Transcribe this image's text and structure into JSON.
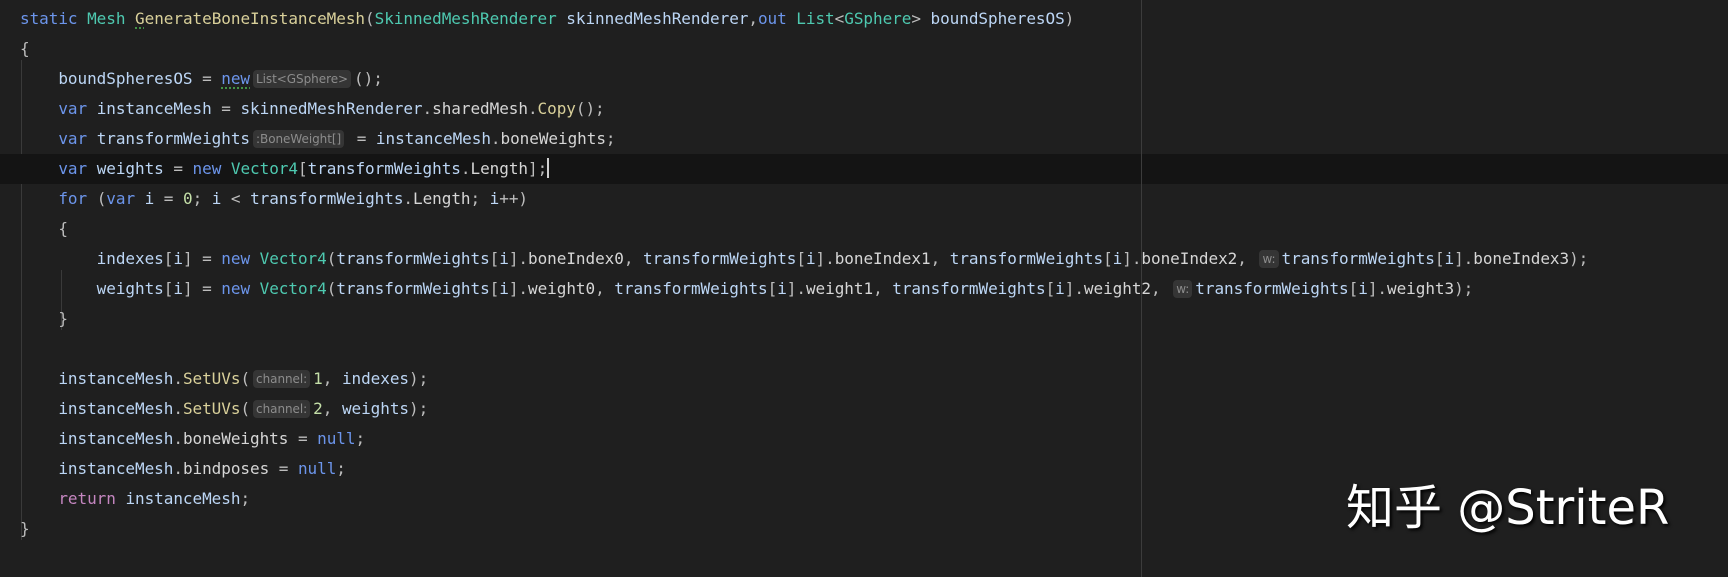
{
  "editor": {
    "current_line": 5,
    "lines": [
      [
        [
          "kw",
          "static "
        ],
        [
          "ty",
          "Mesh "
        ],
        [
          "fn warn",
          "G"
        ],
        [
          "fn",
          "enerateBoneInstanceMesh"
        ],
        [
          "pl",
          "("
        ],
        [
          "ty",
          "SkinnedMeshRenderer "
        ],
        [
          "id",
          "skinnedMeshRenderer"
        ],
        [
          "pl",
          ","
        ],
        [
          "kw",
          "out "
        ],
        [
          "ty",
          "List"
        ],
        [
          "pl",
          "<"
        ],
        [
          "ty",
          "GSphere"
        ],
        [
          "pl",
          "> "
        ],
        [
          "id",
          "boundSpheresOS"
        ],
        [
          "pl",
          ")"
        ]
      ],
      [
        [
          "pl",
          "{"
        ]
      ],
      [
        [
          "pl",
          "    "
        ],
        [
          "id",
          "boundSpheresOS "
        ],
        [
          "pl",
          "= "
        ],
        [
          "kw warn",
          "new"
        ],
        [
          "hint",
          "List<GSphere>"
        ],
        [
          "pl",
          "();"
        ]
      ],
      [
        [
          "pl",
          "    "
        ],
        [
          "kw",
          "var "
        ],
        [
          "id",
          "instanceMesh "
        ],
        [
          "pl",
          "= "
        ],
        [
          "id",
          "skinnedMeshRenderer"
        ],
        [
          "pl",
          "."
        ],
        [
          "field",
          "sharedMesh"
        ],
        [
          "pl",
          "."
        ],
        [
          "fn",
          "Copy"
        ],
        [
          "pl",
          "();"
        ]
      ],
      [
        [
          "pl",
          "    "
        ],
        [
          "kw",
          "var "
        ],
        [
          "id",
          "transformWeights"
        ],
        [
          "hint",
          ":BoneWeight[]"
        ],
        [
          "pl",
          " = "
        ],
        [
          "id",
          "instanceMesh"
        ],
        [
          "pl",
          "."
        ],
        [
          "field",
          "boneWeights"
        ],
        [
          "pl",
          ";"
        ]
      ],
      [
        [
          "pl",
          "    "
        ],
        [
          "kw",
          "var "
        ],
        [
          "id",
          "weights "
        ],
        [
          "pl",
          "= "
        ],
        [
          "kw",
          "new "
        ],
        [
          "ty",
          "Vector4"
        ],
        [
          "pl",
          "["
        ],
        [
          "id",
          "transformWeights"
        ],
        [
          "pl",
          "."
        ],
        [
          "field",
          "Length"
        ],
        [
          "pl",
          "];"
        ],
        [
          "caret",
          ""
        ]
      ],
      [
        [
          "pl",
          "    "
        ],
        [
          "kw",
          "for "
        ],
        [
          "pl",
          "("
        ],
        [
          "kw",
          "var "
        ],
        [
          "id",
          "i "
        ],
        [
          "pl",
          "= "
        ],
        [
          "num",
          "0"
        ],
        [
          "pl",
          "; "
        ],
        [
          "id",
          "i "
        ],
        [
          "pl",
          "< "
        ],
        [
          "id",
          "transformWeights"
        ],
        [
          "pl",
          "."
        ],
        [
          "field",
          "Length"
        ],
        [
          "pl",
          "; "
        ],
        [
          "id",
          "i"
        ],
        [
          "pl",
          "++)"
        ]
      ],
      [
        [
          "pl",
          "    {"
        ]
      ],
      [
        [
          "pl",
          "        "
        ],
        [
          "id",
          "indexes"
        ],
        [
          "pl",
          "["
        ],
        [
          "id",
          "i"
        ],
        [
          "pl",
          "] = "
        ],
        [
          "kw",
          "new "
        ],
        [
          "ty",
          "Vector4"
        ],
        [
          "pl",
          "("
        ],
        [
          "id",
          "transformWeights"
        ],
        [
          "pl",
          "["
        ],
        [
          "id",
          "i"
        ],
        [
          "pl",
          "]."
        ],
        [
          "field",
          "boneIndex0"
        ],
        [
          "pl",
          ", "
        ],
        [
          "id",
          "transformWeights"
        ],
        [
          "pl",
          "["
        ],
        [
          "id",
          "i"
        ],
        [
          "pl",
          "]."
        ],
        [
          "field",
          "boneIndex1"
        ],
        [
          "pl",
          ", "
        ],
        [
          "id",
          "transformWeights"
        ],
        [
          "pl",
          "["
        ],
        [
          "id",
          "i"
        ],
        [
          "pl",
          "]."
        ],
        [
          "field",
          "boneIndex2"
        ],
        [
          "pl",
          ", "
        ],
        [
          "hint",
          "w:"
        ],
        [
          "id",
          "transformWeights"
        ],
        [
          "pl",
          "["
        ],
        [
          "id",
          "i"
        ],
        [
          "pl",
          "]."
        ],
        [
          "field",
          "boneIndex3"
        ],
        [
          "pl",
          ");"
        ]
      ],
      [
        [
          "pl",
          "        "
        ],
        [
          "id",
          "weights"
        ],
        [
          "pl",
          "["
        ],
        [
          "id",
          "i"
        ],
        [
          "pl",
          "] = "
        ],
        [
          "kw",
          "new "
        ],
        [
          "ty",
          "Vector4"
        ],
        [
          "pl",
          "("
        ],
        [
          "id",
          "transformWeights"
        ],
        [
          "pl",
          "["
        ],
        [
          "id",
          "i"
        ],
        [
          "pl",
          "]."
        ],
        [
          "field",
          "weight0"
        ],
        [
          "pl",
          ", "
        ],
        [
          "id",
          "transformWeights"
        ],
        [
          "pl",
          "["
        ],
        [
          "id",
          "i"
        ],
        [
          "pl",
          "]."
        ],
        [
          "field",
          "weight1"
        ],
        [
          "pl",
          ", "
        ],
        [
          "id",
          "transformWeights"
        ],
        [
          "pl",
          "["
        ],
        [
          "id",
          "i"
        ],
        [
          "pl",
          "]."
        ],
        [
          "field",
          "weight2"
        ],
        [
          "pl",
          ", "
        ],
        [
          "hint",
          "w:"
        ],
        [
          "id",
          "transformWeights"
        ],
        [
          "pl",
          "["
        ],
        [
          "id",
          "i"
        ],
        [
          "pl",
          "]."
        ],
        [
          "field",
          "weight3"
        ],
        [
          "pl",
          ");"
        ]
      ],
      [
        [
          "pl",
          "    }"
        ]
      ],
      [],
      [
        [
          "pl",
          "    "
        ],
        [
          "id",
          "instanceMesh"
        ],
        [
          "pl",
          "."
        ],
        [
          "fn",
          "SetUVs"
        ],
        [
          "pl",
          "("
        ],
        [
          "hint",
          "channel:"
        ],
        [
          "num",
          "1"
        ],
        [
          "pl",
          ", "
        ],
        [
          "id",
          "indexes"
        ],
        [
          "pl",
          ");"
        ]
      ],
      [
        [
          "pl",
          "    "
        ],
        [
          "id",
          "instanceMesh"
        ],
        [
          "pl",
          "."
        ],
        [
          "fn",
          "SetUVs"
        ],
        [
          "pl",
          "("
        ],
        [
          "hint",
          "channel:"
        ],
        [
          "num",
          "2"
        ],
        [
          "pl",
          ", "
        ],
        [
          "id",
          "weights"
        ],
        [
          "pl",
          ");"
        ]
      ],
      [
        [
          "pl",
          "    "
        ],
        [
          "id",
          "instanceMesh"
        ],
        [
          "pl",
          "."
        ],
        [
          "field",
          "boneWeights "
        ],
        [
          "pl",
          "= "
        ],
        [
          "kw",
          "null"
        ],
        [
          "pl",
          ";"
        ]
      ],
      [
        [
          "pl",
          "    "
        ],
        [
          "id",
          "instanceMesh"
        ],
        [
          "pl",
          "."
        ],
        [
          "field",
          "bindposes "
        ],
        [
          "pl",
          "= "
        ],
        [
          "kw",
          "null"
        ],
        [
          "pl",
          ";"
        ]
      ],
      [
        [
          "pl",
          "    "
        ],
        [
          "ret",
          "return "
        ],
        [
          "id",
          "instanceMesh"
        ],
        [
          "pl",
          ";"
        ]
      ],
      [
        [
          "pl",
          "}"
        ]
      ]
    ]
  },
  "watermark": "知乎 @StriteR"
}
